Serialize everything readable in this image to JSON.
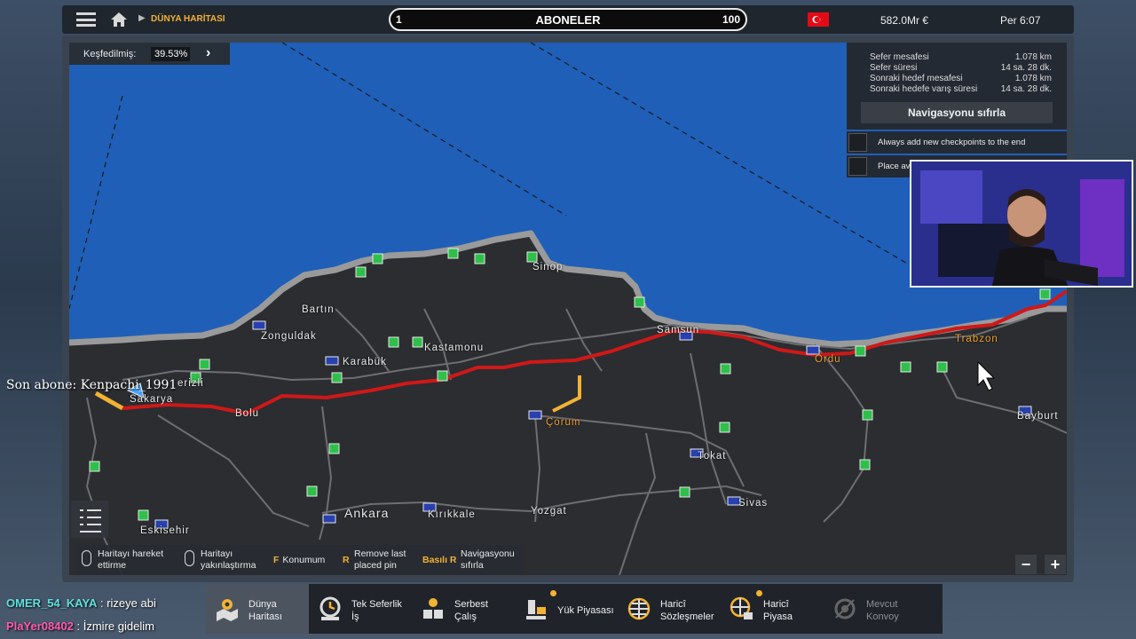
{
  "topbar": {
    "breadcrumb": "DÜNYA HARİTASI",
    "subs_min": "1",
    "subs_title": "ABONELER",
    "subs_max": "100",
    "money": "582.0Mr €",
    "time": "Per 6:07"
  },
  "explored": {
    "label": "Keşfedilmiş:",
    "value": "39.53%"
  },
  "nav": {
    "rows": [
      {
        "label": "Sefer mesafesi",
        "value": "1.078 km"
      },
      {
        "label": "Sefer süresi",
        "value": "14 sa. 28 dk."
      },
      {
        "label": "Sonraki hedef mesafesi",
        "value": "1.078 km"
      },
      {
        "label": "Sonraki hedefe varış süresi",
        "value": "14 sa. 28 dk."
      }
    ],
    "reset": "Navigasyonu sıfırla",
    "opt1": "Always add new checkpoints to the end",
    "opt2": "Place av"
  },
  "cities": {
    "sinop": "Sinop",
    "bartin": "Bartın",
    "zonguldak": "Zonguldak",
    "kastamonu": "Kastamonu",
    "karabuk": "Karabük",
    "samsun": "Samsun",
    "ordu": "Ordu",
    "trabzon": "Trabzon",
    "erizli": "erizli",
    "sakarya": "Sakarya",
    "bolu": "Bolu",
    "corum": "Çorum",
    "tokat": "Tokat",
    "bayburt": "Bayburt",
    "sivas": "Sivas",
    "ankara": "Ankara",
    "kirikkale": "Kırıkkale",
    "yozgat": "Yozgat",
    "eskisehir": "Eskisehir"
  },
  "controls": {
    "c1": "Haritayı hareket ettirme",
    "c2": "Haritayı yakınlaştırma",
    "c3_key": "F",
    "c3": "Konumum",
    "c4_key": "R",
    "c4": "Remove last placed pin",
    "c5_key": "Basılı R",
    "c5": "Navigasyonu sıfırla"
  },
  "overlay": "Son abone: Kenpachi_1991",
  "tabs": [
    {
      "label1": "Dünya",
      "label2": "Haritası"
    },
    {
      "label1": "Tek Seferlik",
      "label2": "İş"
    },
    {
      "label1": "Serbest",
      "label2": "Çalış"
    },
    {
      "label1": "Yük Piyasası",
      "label2": ""
    },
    {
      "label1": "Haricî",
      "label2": "Sözleşmeler"
    },
    {
      "label1": "Haricî",
      "label2": "Piyasa"
    },
    {
      "label1": "Mevcut",
      "label2": "Konvoy"
    }
  ],
  "chat": [
    {
      "user": "OMER_54_KAYA",
      "msg": " : rizeye abi"
    },
    {
      "user": "PlaYer08402",
      "msg": " : İzmire gidelim"
    }
  ],
  "colors": {
    "sea": "#1f5fb8",
    "land": "#2b2d31",
    "route": "#d01818",
    "accent": "#f2b233",
    "pin": "#2ec04a"
  }
}
